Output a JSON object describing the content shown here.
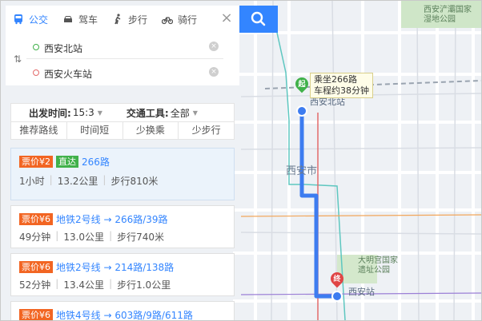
{
  "modes": [
    {
      "label": "公交",
      "icon": "bus-icon",
      "active": true
    },
    {
      "label": "驾车",
      "icon": "car-icon",
      "active": false
    },
    {
      "label": "步行",
      "icon": "walk-icon",
      "active": false
    },
    {
      "label": "骑行",
      "icon": "bike-icon",
      "active": false
    }
  ],
  "route": {
    "origin": "西安北站",
    "destination": "西安火车站"
  },
  "filters": {
    "depart_label": "出发时间:",
    "depart_value": "15:3",
    "tool_label": "交通工具:",
    "tool_value": "全部"
  },
  "sort_tabs": [
    "推荐路线",
    "时间短",
    "少换乘",
    "少步行"
  ],
  "results": [
    {
      "fare": "票价¥2",
      "badge": "直达",
      "route": "266路",
      "time": "1小时",
      "distance": "13.2公里",
      "walk": "步行810米"
    },
    {
      "fare": "票价¥6",
      "route": "地铁2号线 → 266路/39路",
      "time": "49分钟",
      "distance": "13.0公里",
      "walk": "步行740米"
    },
    {
      "fare": "票价¥6",
      "route": "地铁2号线 → 214路/138路",
      "time": "52分钟",
      "distance": "13.4公里",
      "walk": "步行1.0公里"
    },
    {
      "fare": "票价¥6",
      "route": "地铁4号线 → 603路/9路/611路"
    }
  ],
  "map": {
    "callout_line1": "乘坐266路",
    "callout_line2": "车程约38分钟",
    "start_marker": "起",
    "end_marker": "终",
    "labels": {
      "xian_city": "西安市",
      "park1_line1": "西安浐灞国家",
      "park1_line2": "湿地公园",
      "park2_line1": "大明宫国家",
      "park2_line2": "遗址公园",
      "station_north": "西安北站",
      "station_rail": "西安站"
    }
  },
  "colors": {
    "accent": "#3385ff",
    "fare": "#f26522",
    "direct": "#40b14a",
    "route_line": "#3d7cf0"
  }
}
